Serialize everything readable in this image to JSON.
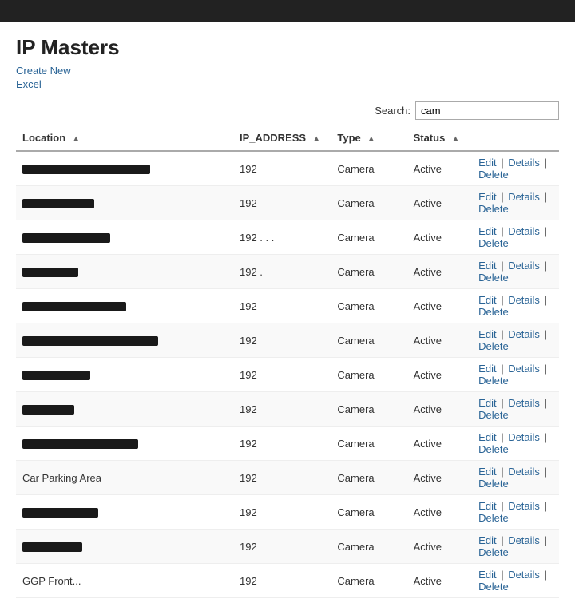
{
  "topbar": {},
  "page": {
    "title": "IP Masters",
    "links": [
      {
        "label": "Create New",
        "href": "#"
      },
      {
        "label": "Excel",
        "href": "#"
      }
    ]
  },
  "search": {
    "label": "Search:",
    "value": "cam",
    "placeholder": ""
  },
  "table": {
    "columns": [
      {
        "label": "Location",
        "key": "location",
        "sortable": true
      },
      {
        "label": "IP_ADDRESS",
        "key": "ip_address",
        "sortable": true
      },
      {
        "label": "Type",
        "key": "type",
        "sortable": true
      },
      {
        "label": "Status",
        "key": "status",
        "sortable": true
      },
      {
        "label": "",
        "key": "actions",
        "sortable": false
      }
    ],
    "rows": [
      {
        "location": "REDACTED_LONG",
        "redactedWidth": 160,
        "ip": "192",
        "type": "Camera",
        "status": "Active"
      },
      {
        "location": "REDACTED_SHORT",
        "redactedWidth": 90,
        "ip": "192",
        "type": "Camera",
        "status": "Active"
      },
      {
        "location": "REDACTED_MED",
        "redactedWidth": 110,
        "ip": "192 . . .",
        "type": "Camera",
        "status": "Active"
      },
      {
        "location": "REDACTED_TINY",
        "redactedWidth": 70,
        "ip": "192 .",
        "type": "Camera",
        "status": "Active"
      },
      {
        "location": "REDACTED_MED2",
        "redactedWidth": 130,
        "ip": "192",
        "type": "Camera",
        "status": "Active"
      },
      {
        "location": "REDACTED_LONG2",
        "redactedWidth": 170,
        "ip": "192",
        "type": "Camera",
        "status": "Active"
      },
      {
        "location": "REDACTED_S2",
        "redactedWidth": 85,
        "ip": "192",
        "type": "Camera",
        "status": "Active"
      },
      {
        "location": "REDACTED_S3",
        "redactedWidth": 65,
        "ip": "192",
        "type": "Camera",
        "status": "Active"
      },
      {
        "location": "REDACTED_MED3",
        "redactedWidth": 145,
        "ip": "192",
        "type": "Camera",
        "status": "Active"
      },
      {
        "location": "Car Parking Area",
        "redactedWidth": 0,
        "ip": "192",
        "type": "Camera",
        "status": "Active"
      },
      {
        "location": "REDACTED_S4",
        "redactedWidth": 95,
        "ip": "192",
        "type": "Camera",
        "status": "Active"
      },
      {
        "location": "REDACTED_S5",
        "redactedWidth": 75,
        "ip": "192",
        "type": "Camera",
        "status": "Active"
      },
      {
        "location": "GGP Front...",
        "redactedWidth": 0,
        "ip": "192",
        "type": "Camera",
        "status": "Active"
      }
    ],
    "actions": {
      "edit": "Edit",
      "sep1": " | ",
      "details": "Details",
      "sep2": " | ",
      "delete": "Delete"
    }
  },
  "colors": {
    "link": "#2a6496",
    "redacted": "#1a1a1a"
  }
}
